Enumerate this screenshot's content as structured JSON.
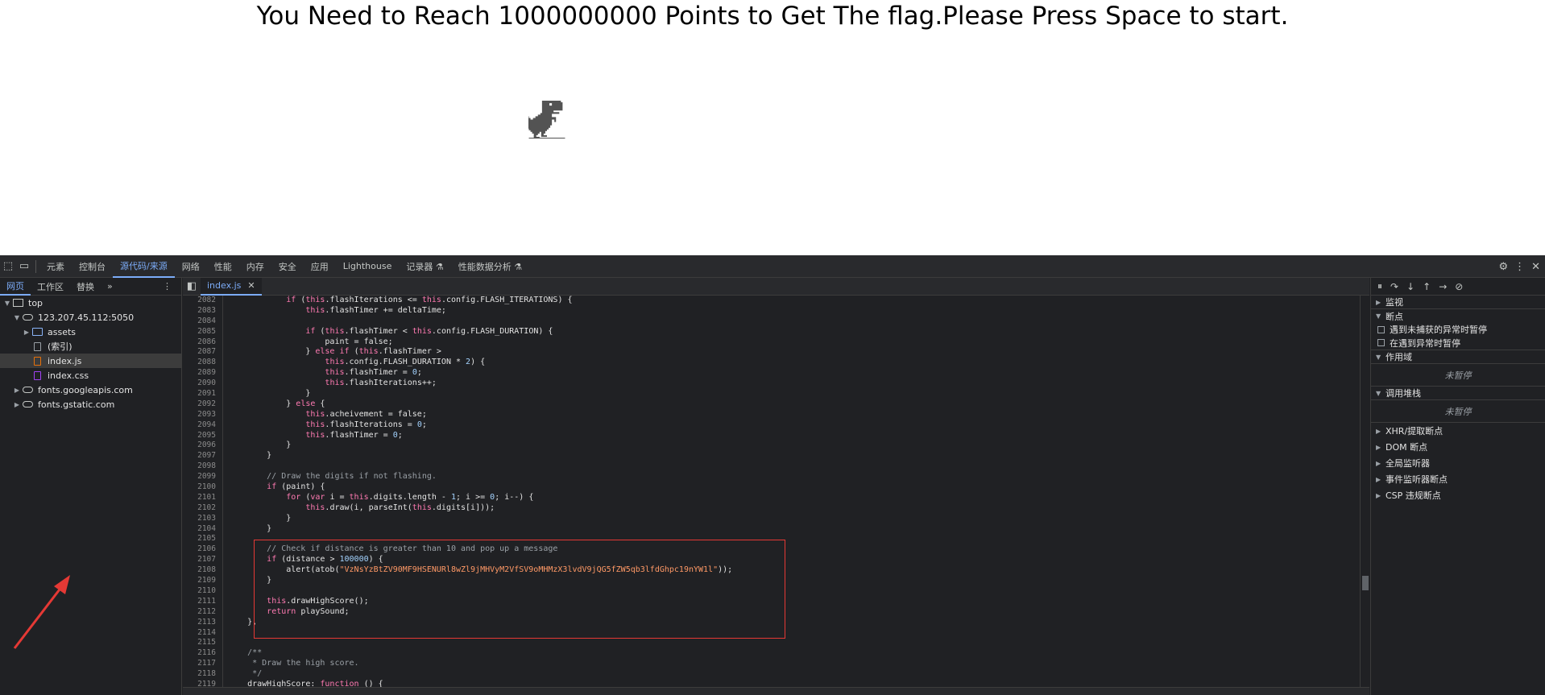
{
  "game": {
    "title": "You Need to Reach 1000000000 Points to Get The flag.Please Press Space to start."
  },
  "devtools": {
    "tabs": [
      "元素",
      "控制台",
      "源代码/来源",
      "网络",
      "性能",
      "内存",
      "安全",
      "应用",
      "Lighthouse",
      "记录器 ⚗",
      "性能数据分析 ⚗"
    ],
    "active_tab": "源代码/来源",
    "navigator": {
      "tabs": [
        "网页",
        "工作区",
        "替换"
      ],
      "more": "»",
      "tree": [
        {
          "label": "top",
          "indent": 0,
          "tri": "▼",
          "icon": "frame"
        },
        {
          "label": "123.207.45.112:5050",
          "indent": 1,
          "tri": "▼",
          "icon": "cloud"
        },
        {
          "label": "assets",
          "indent": 2,
          "tri": "▶",
          "icon": "folder"
        },
        {
          "label": "(索引)",
          "indent": 2,
          "tri": "",
          "icon": "file"
        },
        {
          "label": "index.js",
          "indent": 2,
          "tri": "",
          "icon": "js"
        },
        {
          "label": "index.css",
          "indent": 2,
          "tri": "",
          "icon": "css"
        },
        {
          "label": "fonts.googleapis.com",
          "indent": 1,
          "tri": "▶",
          "icon": "cloud"
        },
        {
          "label": "fonts.gstatic.com",
          "indent": 1,
          "tri": "▶",
          "icon": "cloud"
        }
      ]
    },
    "editor": {
      "tab_label": "index.js",
      "line_numbers": [
        "2082",
        "2083",
        "2084",
        "2085",
        "2086",
        "2087",
        "2088",
        "2089",
        "2090",
        "2091",
        "2092",
        "2093",
        "2094",
        "2095",
        "2096",
        "2097",
        "2098",
        "2099",
        "2100",
        "2101",
        "2102",
        "2103",
        "2104",
        "2105",
        "2106",
        "2107",
        "2108",
        "2109",
        "2110",
        "2111",
        "2112",
        "2113",
        "2114",
        "2115",
        "2116",
        "2117",
        "2118",
        "2119"
      ],
      "code_lines": [
        "            if (this.flashIterations <= this.config.FLASH_ITERATIONS) {",
        "                this.flashTimer += deltaTime;",
        "",
        "                if (this.flashTimer < this.config.FLASH_DURATION) {",
        "                    paint = false;",
        "                } else if (this.flashTimer >",
        "                    this.config.FLASH_DURATION * 2) {",
        "                    this.flashTimer = 0;",
        "                    this.flashIterations++;",
        "                }",
        "            } else {",
        "                this.acheivement = false;",
        "                this.flashIterations = 0;",
        "                this.flashTimer = 0;",
        "            }",
        "        }",
        "",
        "        // Draw the digits if not flashing.",
        "        if (paint) {",
        "            for (var i = this.digits.length - 1; i >= 0; i--) {",
        "                this.draw(i, parseInt(this.digits[i]));",
        "            }",
        "        }",
        "",
        "        // Check if distance is greater than 10 and pop up a message",
        "        if (distance > 100000) {",
        "            alert(atob(\"VzNsYzBtZV90MF9HSENURl8wZl9jMHVyM2VfSV9oMHMzX3lvdV9jQG5fZW5qb3lfdGhpc19nYW1l\"));",
        "        }",
        "",
        "        this.drawHighScore();",
        "        return playSound;",
        "    },",
        "",
        "",
        "    /**",
        "     * Draw the high score.",
        "     */",
        "    drawHighScore: function () {"
      ]
    },
    "debugger": {
      "sections": {
        "watch": "监视",
        "breakpoints": "断点",
        "pause_uncaught": "遇到未捕获的异常时暂停",
        "pause_caught": "在遇到异常时暂停",
        "scope": "作用域",
        "not_paused_1": "未暂停",
        "call_stack": "调用堆栈",
        "not_paused_2": "未暂停",
        "xhr": "XHR/提取断点",
        "dom": "DOM 断点",
        "global": "全局监听器",
        "event": "事件监听器断点",
        "csp": "CSP 违规断点"
      }
    }
  }
}
